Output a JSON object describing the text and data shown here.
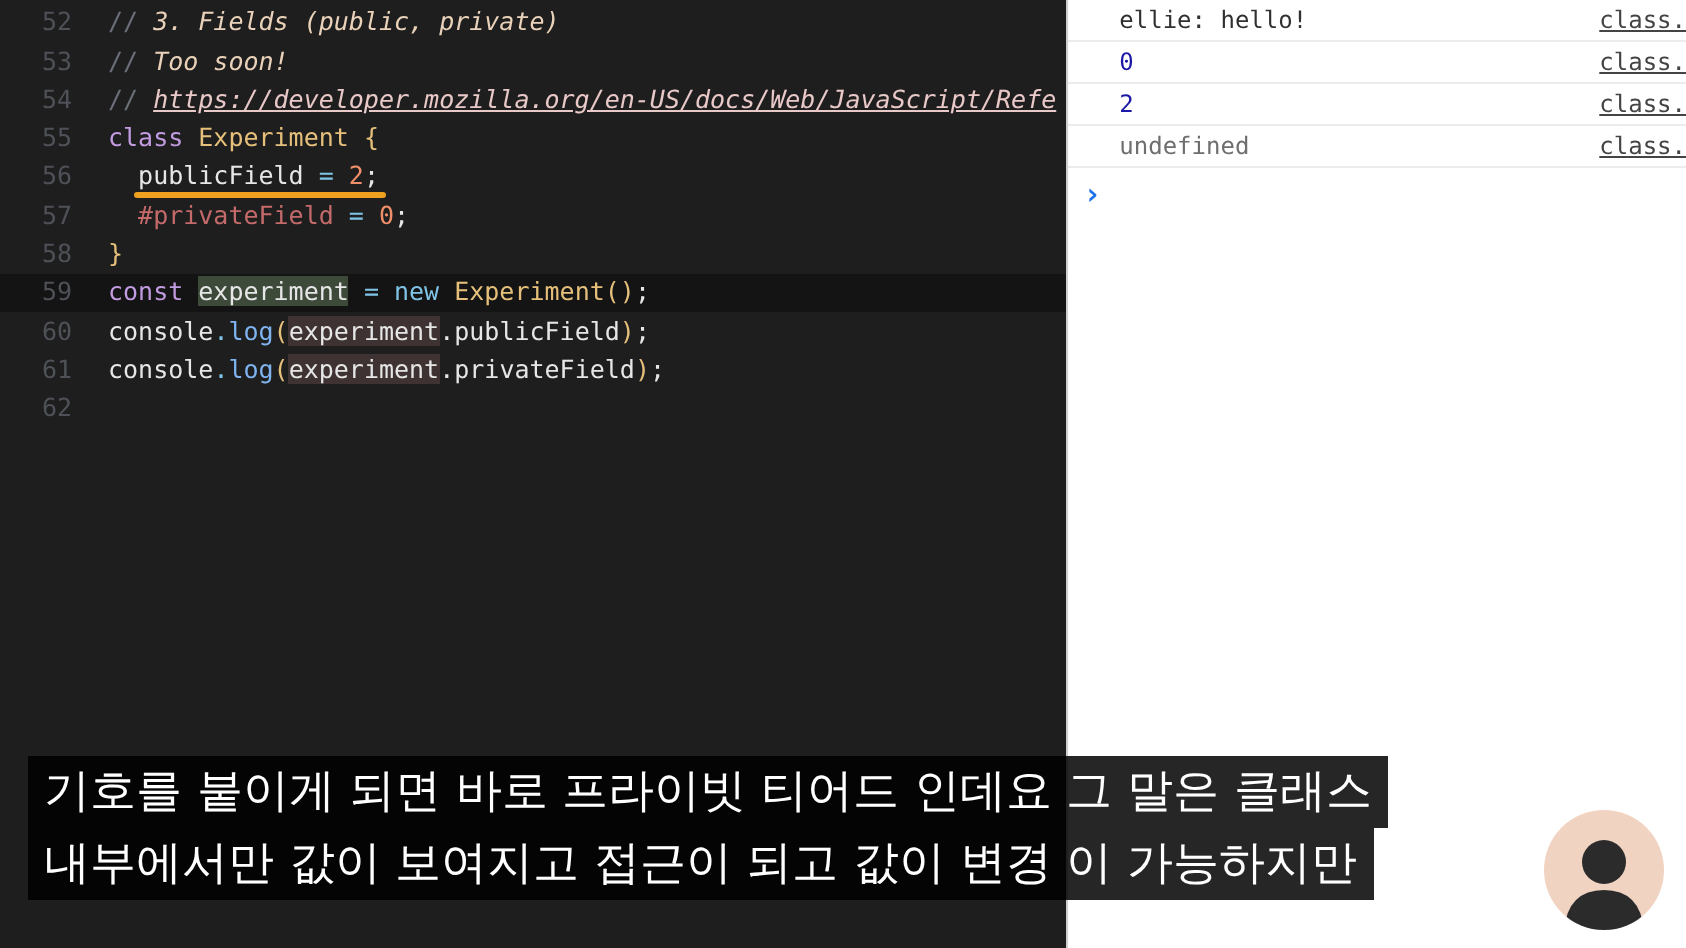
{
  "editor": {
    "lines": [
      {
        "number": "52",
        "current": false,
        "annotated": false,
        "tokens": [
          {
            "kind": "comment",
            "text": "// "
          },
          {
            "kind": "comment-italic",
            "text": "3. Fields (public, private)"
          }
        ]
      },
      {
        "number": "53",
        "current": false,
        "annotated": false,
        "tokens": [
          {
            "kind": "comment",
            "text": "// "
          },
          {
            "kind": "comment-italic",
            "text": "Too soon!"
          }
        ]
      },
      {
        "number": "54",
        "current": false,
        "annotated": false,
        "tokens": [
          {
            "kind": "comment",
            "text": "// "
          },
          {
            "kind": "link",
            "text": "https://developer.mozilla.org/en-US/docs/Web/JavaScript/Refe"
          }
        ]
      },
      {
        "number": "55",
        "current": false,
        "annotated": false,
        "tokens": [
          {
            "kind": "keyword",
            "text": "class "
          },
          {
            "kind": "class",
            "text": "Experiment"
          },
          {
            "kind": "brace",
            "text": " {"
          }
        ]
      },
      {
        "number": "56",
        "current": false,
        "annotated": true,
        "tokens": [
          {
            "kind": "plain",
            "text": "  publicField"
          },
          {
            "kind": "operator",
            "text": " = "
          },
          {
            "kind": "number",
            "text": "2"
          },
          {
            "kind": "plain",
            "text": ";"
          }
        ]
      },
      {
        "number": "57",
        "current": false,
        "annotated": false,
        "tokens": [
          {
            "kind": "private",
            "text": "  #privateField"
          },
          {
            "kind": "operator",
            "text": " = "
          },
          {
            "kind": "number",
            "text": "0"
          },
          {
            "kind": "plain",
            "text": ";"
          }
        ]
      },
      {
        "number": "58",
        "current": false,
        "annotated": false,
        "tokens": [
          {
            "kind": "brace",
            "text": "}"
          }
        ]
      },
      {
        "number": "59",
        "current": true,
        "annotated": false,
        "tokens": [
          {
            "kind": "keyword",
            "text": "const "
          },
          {
            "kind": "highlight",
            "text": "experiment"
          },
          {
            "kind": "operator",
            "text": " = "
          },
          {
            "kind": "new",
            "text": "new "
          },
          {
            "kind": "class",
            "text": "Experiment"
          },
          {
            "kind": "brace",
            "text": "()"
          },
          {
            "kind": "plain",
            "text": ";"
          }
        ]
      },
      {
        "number": "60",
        "current": false,
        "annotated": false,
        "tokens": [
          {
            "kind": "plain",
            "text": "console"
          },
          {
            "kind": "operator",
            "text": "."
          },
          {
            "kind": "func",
            "text": "log"
          },
          {
            "kind": "brace",
            "text": "("
          },
          {
            "kind": "ref",
            "text": "experiment"
          },
          {
            "kind": "plain",
            "text": ".publicField"
          },
          {
            "kind": "brace",
            "text": ")"
          },
          {
            "kind": "plain",
            "text": ";"
          }
        ]
      },
      {
        "number": "61",
        "current": false,
        "annotated": false,
        "tokens": [
          {
            "kind": "plain",
            "text": "console"
          },
          {
            "kind": "operator",
            "text": "."
          },
          {
            "kind": "func",
            "text": "log"
          },
          {
            "kind": "brace",
            "text": "("
          },
          {
            "kind": "ref",
            "text": "experiment"
          },
          {
            "kind": "plain",
            "text": ".privateField"
          },
          {
            "kind": "brace",
            "text": ")"
          },
          {
            "kind": "plain",
            "text": ";"
          }
        ]
      },
      {
        "number": "62",
        "current": false,
        "annotated": false
      }
    ]
  },
  "console": {
    "rows": [
      {
        "kind": "string",
        "text": "ellie: hello!",
        "source": "class."
      },
      {
        "kind": "number",
        "text": "0",
        "source": "class."
      },
      {
        "kind": "number",
        "text": "2",
        "source": "class."
      },
      {
        "kind": "undefined",
        "text": "undefined",
        "source": "class."
      }
    ],
    "prompt": "›"
  },
  "subtitles": [
    "기호를 붙이게 되면 바로 프라이빗 티어드 인데요 그 말은 클래스",
    "내부에서만 값이 보여지고 접근이 되고 값이 변경 이 가능하지만"
  ]
}
